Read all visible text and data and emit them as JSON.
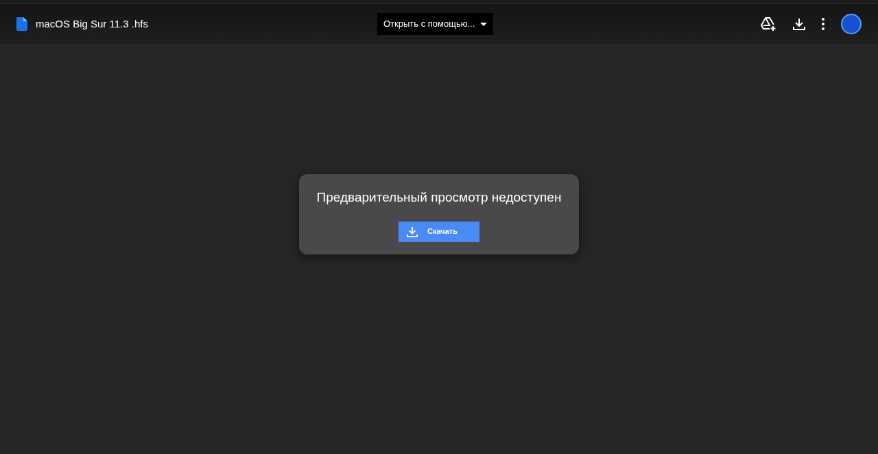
{
  "header": {
    "file_name": "macOS Big Sur 11.3 .hfs",
    "open_with": "Открыть с помощью..."
  },
  "dialog": {
    "message": "Предварительный просмотр недоступен",
    "button": "Скачать"
  }
}
